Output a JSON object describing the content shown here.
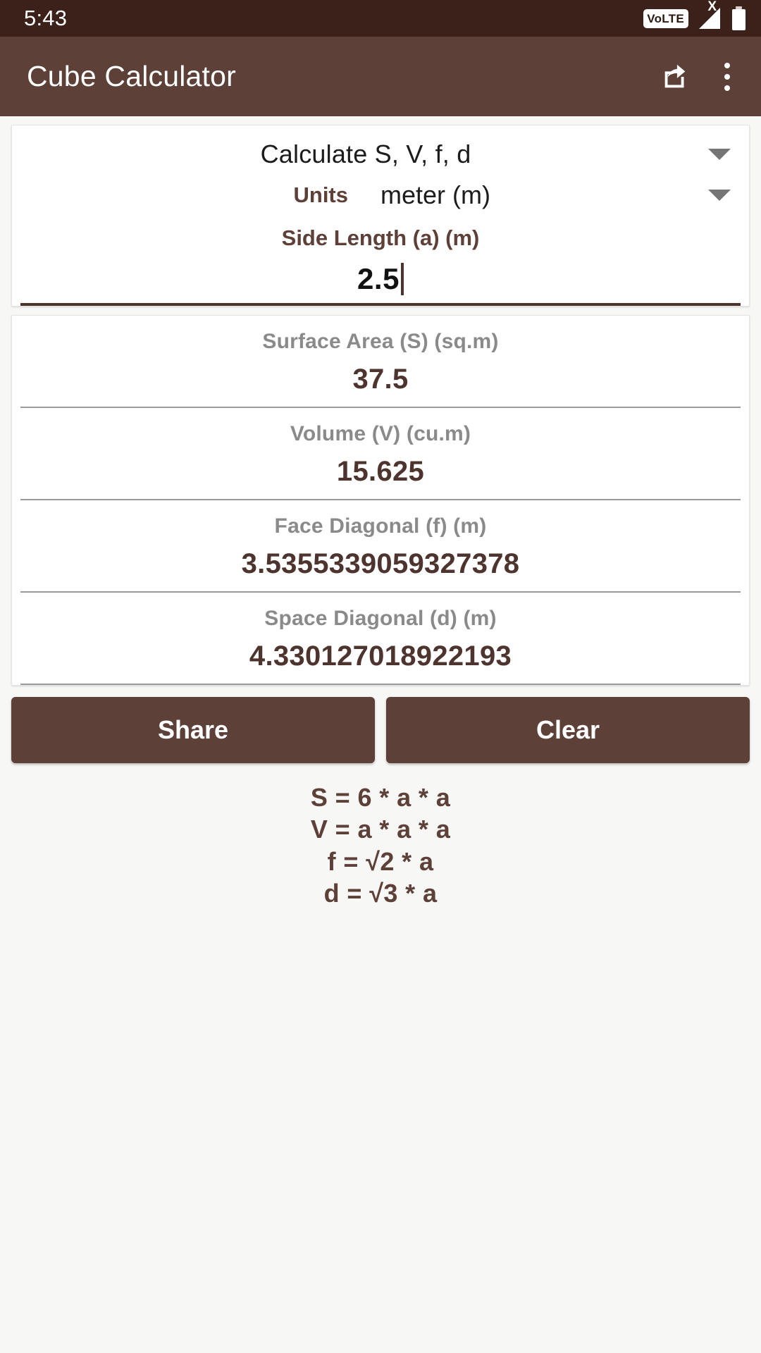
{
  "status_bar": {
    "time": "5:43",
    "volte_label": "VoLTE",
    "signal_x": "X"
  },
  "app_bar": {
    "title": "Cube Calculator",
    "share_icon": "share-icon",
    "overflow_icon": "more-vertical-icon"
  },
  "input_card": {
    "mode_select": {
      "value": "Calculate S, V, f, d",
      "caret_icon": "chevron-down-icon"
    },
    "units": {
      "label": "Units",
      "value": "meter (m)",
      "caret_icon": "chevron-down-icon"
    },
    "side_length": {
      "label": "Side Length (a) (m)",
      "value": "2.5",
      "placeholder": ""
    }
  },
  "results": [
    {
      "label": "Surface Area (S) (sq.m)",
      "value": "37.5"
    },
    {
      "label": "Volume (V) (cu.m)",
      "value": "15.625"
    },
    {
      "label": "Face Diagonal (f) (m)",
      "value": "3.5355339059327378"
    },
    {
      "label": "Space Diagonal (d) (m)",
      "value": "4.330127018922193"
    }
  ],
  "actions": {
    "share_label": "Share",
    "clear_label": "Clear"
  },
  "formulas": [
    "S = 6 * a * a",
    "V = a * a * a",
    "f = √2 * a",
    "d = √3 * a"
  ],
  "colors": {
    "status_bar_bg": "#3b211a",
    "app_bar_bg": "#5d4037",
    "accent_brown": "#5d4037",
    "value_brown": "#4e342e",
    "label_gray": "#8a8a8a",
    "page_bg": "#f7f7f5"
  }
}
